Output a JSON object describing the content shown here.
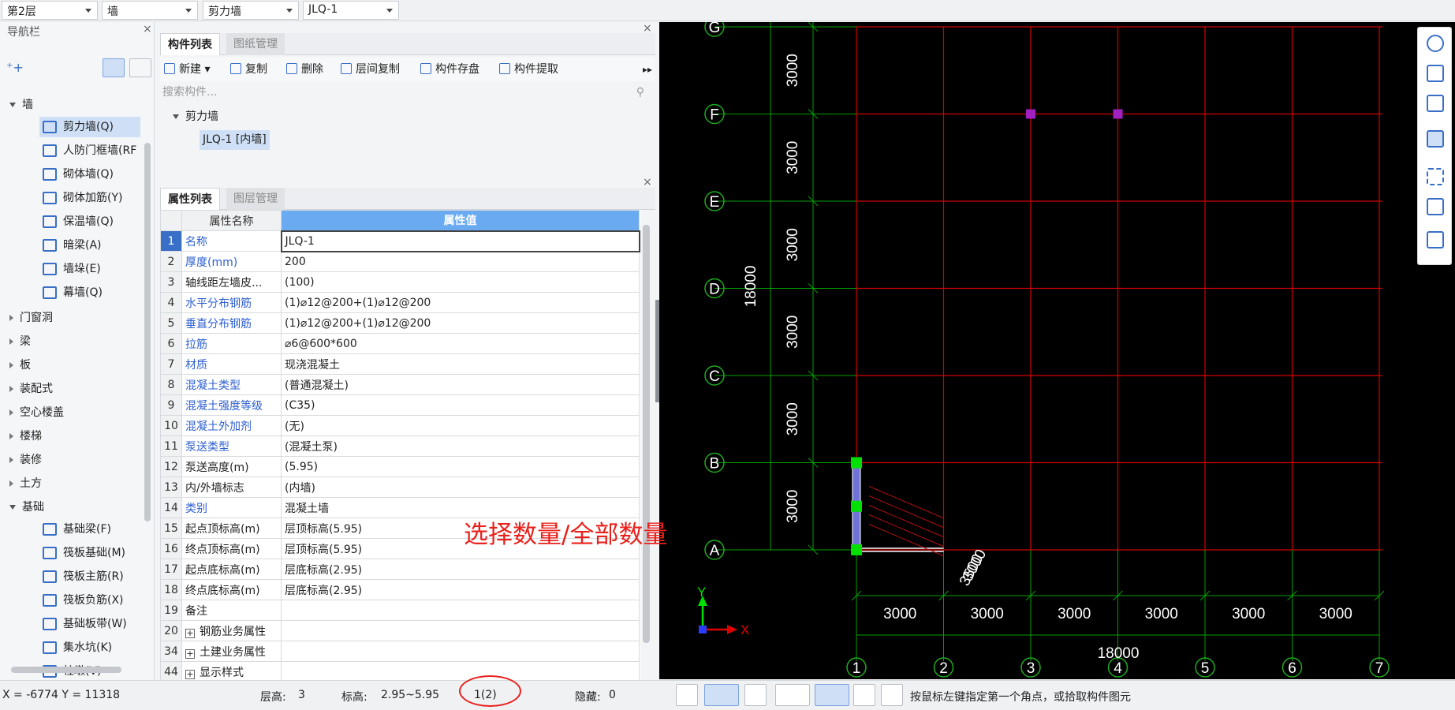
{
  "topbar": {
    "floor": "第2层",
    "category": "墙",
    "type": "剪力墙",
    "component": "JLQ-1"
  },
  "nav": {
    "title": "导航栏",
    "groups": [
      {
        "label": "墙",
        "expanded": true,
        "items": [
          "剪力墙(Q)",
          "人防门框墙(RF",
          "砌体墙(Q)",
          "砌体加筋(Y)",
          "保温墙(Q)",
          "暗梁(A)",
          "墙垛(E)",
          "幕墙(Q)"
        ]
      },
      {
        "label": "门窗洞"
      },
      {
        "label": "梁"
      },
      {
        "label": "板"
      },
      {
        "label": "装配式"
      },
      {
        "label": "空心楼盖"
      },
      {
        "label": "楼梯"
      },
      {
        "label": "装修"
      },
      {
        "label": "土方"
      },
      {
        "label": "基础",
        "expanded": true,
        "items": [
          "基础梁(F)",
          "筏板基础(M)",
          "筏板主筋(R)",
          "筏板负筋(X)",
          "基础板带(W)",
          "集水坑(K)",
          "柱墩(V)"
        ]
      }
    ]
  },
  "component_panel": {
    "tabs": [
      "构件列表",
      "图纸管理"
    ],
    "toolbar": [
      "新建",
      "复制",
      "删除",
      "层间复制",
      "构件存盘",
      "构件提取"
    ],
    "search_placeholder": "搜索构件...",
    "tree_group": "剪力墙",
    "tree_item": "JLQ-1 [内墙]"
  },
  "property_panel": {
    "tabs": [
      "属性列表",
      "图层管理"
    ],
    "header_name": "属性名称",
    "header_value": "属性值",
    "rows": [
      {
        "n": "1",
        "name": "名称",
        "value": "JLQ-1",
        "blue": true
      },
      {
        "n": "2",
        "name": "厚度(mm)",
        "value": "200",
        "blue": true
      },
      {
        "n": "3",
        "name": "轴线距左墙皮...",
        "value": "(100)",
        "blue": false
      },
      {
        "n": "4",
        "name": "水平分布钢筋",
        "value": "(1)⌀12@200+(1)⌀12@200",
        "blue": true
      },
      {
        "n": "5",
        "name": "垂直分布钢筋",
        "value": "(1)⌀12@200+(1)⌀12@200",
        "blue": true
      },
      {
        "n": "6",
        "name": "拉筋",
        "value": "⌀6@600*600",
        "blue": true
      },
      {
        "n": "7",
        "name": "材质",
        "value": "现浇混凝土",
        "blue": true
      },
      {
        "n": "8",
        "name": "混凝土类型",
        "value": "(普通混凝土)",
        "blue": true
      },
      {
        "n": "9",
        "name": "混凝土强度等级",
        "value": "(C35)",
        "blue": true
      },
      {
        "n": "10",
        "name": "混凝土外加剂",
        "value": "(无)",
        "blue": true
      },
      {
        "n": "11",
        "name": "泵送类型",
        "value": "(混凝土泵)",
        "blue": true
      },
      {
        "n": "12",
        "name": "泵送高度(m)",
        "value": "(5.95)",
        "blue": false
      },
      {
        "n": "13",
        "name": "内/外墙标志",
        "value": "(内墙)",
        "blue": false
      },
      {
        "n": "14",
        "name": "类别",
        "value": "混凝土墙",
        "blue": true
      },
      {
        "n": "15",
        "name": "起点顶标高(m)",
        "value": "层顶标高(5.95)",
        "blue": false
      },
      {
        "n": "16",
        "name": "终点顶标高(m)",
        "value": "层顶标高(5.95)",
        "blue": false
      },
      {
        "n": "17",
        "name": "起点底标高(m)",
        "value": "层底标高(2.95)",
        "blue": false
      },
      {
        "n": "18",
        "name": "终点底标高(m)",
        "value": "层底标高(2.95)",
        "blue": false
      },
      {
        "n": "19",
        "name": "备注",
        "value": "",
        "blue": false
      },
      {
        "n": "20",
        "name": "钢筋业务属性",
        "value": "",
        "blue": false,
        "plus": true
      },
      {
        "n": "34",
        "name": "土建业务属性",
        "value": "",
        "blue": false,
        "plus": true
      },
      {
        "n": "44",
        "name": "显示样式",
        "value": "",
        "blue": false,
        "plus": true
      }
    ]
  },
  "canvas": {
    "row_axes": [
      "G",
      "F",
      "E",
      "D",
      "C",
      "B",
      "A"
    ],
    "col_axes": [
      "1",
      "2",
      "3",
      "4",
      "5",
      "6",
      "7"
    ],
    "row_spacing": [
      "3000",
      "3000",
      "3000",
      "3000",
      "3000",
      "3000"
    ],
    "col_spacing": [
      "3000",
      "3000",
      "3000",
      "3000",
      "3000",
      "3000"
    ],
    "total_vertical": "18000",
    "total_horizontal": "18000",
    "rotated_dim": "3000",
    "rotated_dim2": "3500",
    "axis_x": "X",
    "axis_y": "Y",
    "colors": {
      "grid": "#d00000",
      "axis": "#00a000",
      "bubble": "#1fa81f",
      "wall": "#6f73d8",
      "grip": "#00e000",
      "point": "#a020c0"
    }
  },
  "annotation": "选择数量/全部数量",
  "status": {
    "coords": "X = -6774 Y = 11318",
    "floor_height_label": "层高:",
    "floor_height": "3",
    "elev_label": "标高:",
    "elev": "2.95~5.95",
    "selection": "1(2)",
    "hidden_label": "隐藏:",
    "hidden": "0",
    "hint": "按鼠标左键指定第一个角点，或拾取构件图元"
  }
}
